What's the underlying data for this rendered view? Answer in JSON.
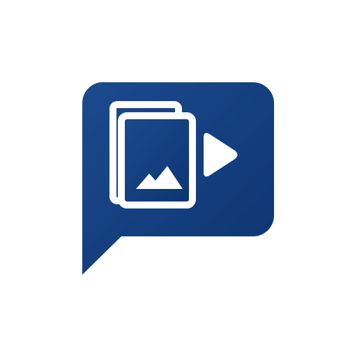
{
  "icon": {
    "name": "media-gallery-chat-bubble-icon",
    "parts": [
      "speech-bubble",
      "photo-stack",
      "mountain-image",
      "play-triangle"
    ],
    "colors": {
      "bubble_top": "#1c4a8d",
      "bubble_bottom": "#0d3471",
      "glyph": "#ffffff",
      "background": "#ffffff"
    }
  }
}
